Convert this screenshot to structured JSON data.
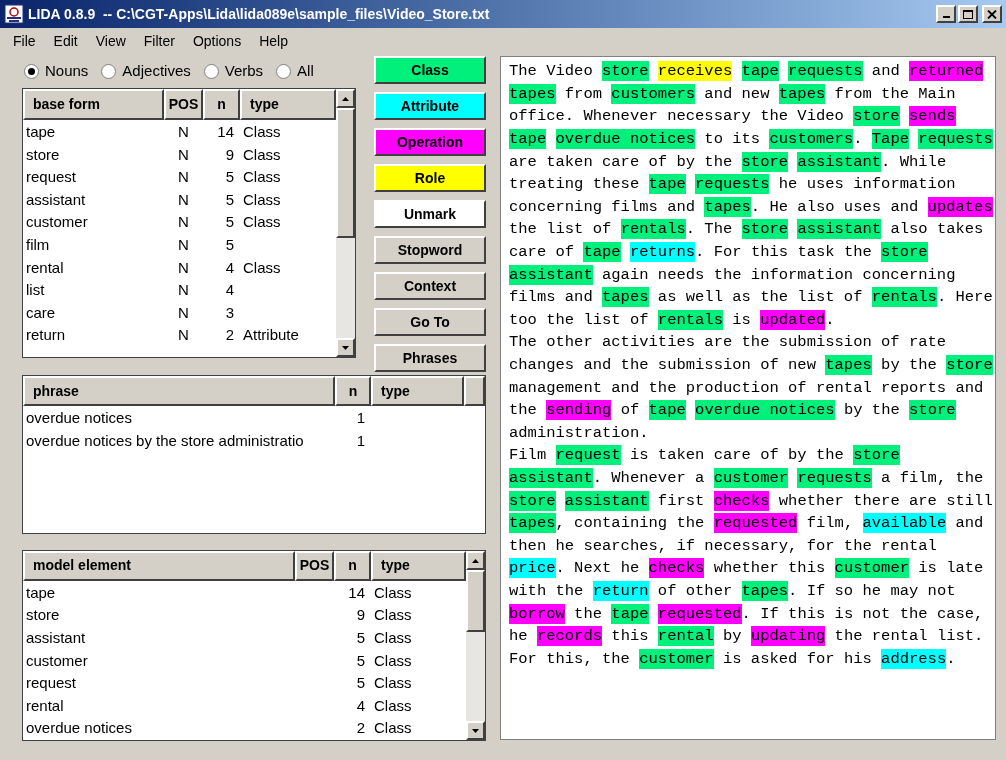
{
  "window": {
    "title": "LIDA 0.8.9  -- C:\\CGT-Apps\\Lida\\lida089e\\sample_files\\Video_Store.txt"
  },
  "menu": [
    "File",
    "Edit",
    "View",
    "Filter",
    "Options",
    "Help"
  ],
  "word_filter": [
    {
      "label": "Nouns",
      "selected": true
    },
    {
      "label": "Adjectives",
      "selected": false
    },
    {
      "label": "Verbs",
      "selected": false
    },
    {
      "label": "All",
      "selected": false
    }
  ],
  "words_table": {
    "columns": [
      "base form",
      "POS",
      "n",
      "type"
    ],
    "rows": [
      [
        "tape",
        "N",
        "14",
        "Class"
      ],
      [
        "store",
        "N",
        "9",
        "Class"
      ],
      [
        "request",
        "N",
        "5",
        "Class"
      ],
      [
        "assistant",
        "N",
        "5",
        "Class"
      ],
      [
        "customer",
        "N",
        "5",
        "Class"
      ],
      [
        "film",
        "N",
        "5"
      ],
      [
        "rental",
        "N",
        "4",
        "Class"
      ],
      [
        "list",
        "N",
        "4"
      ],
      [
        "care",
        "N",
        "3"
      ],
      [
        "return",
        "N",
        "2",
        "Attribute"
      ]
    ]
  },
  "buttons": [
    {
      "label": "Class",
      "kind": "class"
    },
    {
      "label": "Attribute",
      "kind": "attribute"
    },
    {
      "label": "Operation",
      "kind": "operation"
    },
    {
      "label": "Role",
      "kind": "role"
    },
    {
      "label": "Unmark",
      "kind": "unmark"
    },
    {
      "label": "Stopword",
      "kind": "plain"
    },
    {
      "label": "Context",
      "kind": "plain"
    },
    {
      "label": "Go To",
      "kind": "plain"
    },
    {
      "label": "Phrases",
      "kind": "plain"
    }
  ],
  "phrases_table": {
    "columns": [
      "phrase",
      "n",
      "type"
    ],
    "rows": [
      [
        "overdue notices",
        "1"
      ],
      [
        "overdue notices by the store administratio",
        "1"
      ]
    ]
  },
  "model_table": {
    "columns": [
      "model element",
      "POS",
      "n",
      "type"
    ],
    "rows": [
      [
        "tape",
        "",
        "14",
        "Class"
      ],
      [
        "store",
        "",
        "9",
        "Class"
      ],
      [
        "assistant",
        "",
        "5",
        "Class"
      ],
      [
        "customer",
        "",
        "5",
        "Class"
      ],
      [
        "request",
        "",
        "5",
        "Class"
      ],
      [
        "rental",
        "",
        "4",
        "Class"
      ],
      [
        "overdue notices",
        "",
        "2",
        "Class"
      ]
    ]
  },
  "text": {
    "lines": [
      [
        {
          "text": "The Video ",
          "kind": "plain"
        },
        {
          "text": "store",
          "kind": "class"
        },
        {
          "text": "receives",
          "kind": "role"
        },
        {
          "text": "tape",
          "kind": "class"
        },
        {
          "text": "requests",
          "kind": "class"
        },
        {
          "text": " and ",
          "kind": "plain"
        },
        {
          "text": "returned",
          "kind": "operation"
        }
      ],
      [
        {
          "text": "tapes",
          "kind": "class"
        },
        {
          "text": " from ",
          "kind": "plain"
        },
        {
          "text": "customers",
          "kind": "class"
        },
        {
          "text": " and new ",
          "kind": "plain"
        },
        {
          "text": "tapes",
          "kind": "class"
        },
        {
          "text": " from the Main",
          "kind": "plain"
        }
      ],
      [
        {
          "text": "office. Whenever necessary the Video ",
          "kind": "plain"
        },
        {
          "text": "store",
          "kind": "class"
        },
        {
          "text": "sends",
          "kind": "operation"
        }
      ],
      [
        {
          "text": "tape",
          "kind": "class"
        },
        {
          "text": "overdue notices",
          "kind": "class"
        },
        {
          "text": " to its ",
          "kind": "plain"
        },
        {
          "text": "customers",
          "kind": "class"
        },
        {
          "text": ". ",
          "kind": "plain"
        },
        {
          "text": "Tape",
          "kind": "class"
        },
        {
          "text": "requests",
          "kind": "class"
        }
      ],
      [
        {
          "text": "are taken care of by the ",
          "kind": "plain"
        },
        {
          "text": "store",
          "kind": "class"
        },
        {
          "text": "assistant",
          "kind": "class"
        },
        {
          "text": ". While",
          "kind": "plain"
        }
      ],
      [
        {
          "text": "treating these ",
          "kind": "plain"
        },
        {
          "text": "tape",
          "kind": "class"
        },
        {
          "text": "requests",
          "kind": "class"
        },
        {
          "text": " he uses information",
          "kind": "plain"
        }
      ],
      [
        {
          "text": "concerning films and ",
          "kind": "plain"
        },
        {
          "text": "tapes",
          "kind": "class"
        },
        {
          "text": ". He also uses and ",
          "kind": "plain"
        },
        {
          "text": "updates",
          "kind": "operation"
        }
      ],
      [
        {
          "text": "the list of ",
          "kind": "plain"
        },
        {
          "text": "rentals",
          "kind": "class"
        },
        {
          "text": ". The ",
          "kind": "plain"
        },
        {
          "text": "store",
          "kind": "class"
        },
        {
          "text": "assistant",
          "kind": "class"
        },
        {
          "text": " also takes",
          "kind": "plain"
        }
      ],
      [
        {
          "text": "care of ",
          "kind": "plain"
        },
        {
          "text": "tape",
          "kind": "class"
        },
        {
          "text": "returns",
          "kind": "attribute"
        },
        {
          "text": ". For this task the ",
          "kind": "plain"
        },
        {
          "text": "store",
          "kind": "class"
        }
      ],
      [
        {
          "text": "assistant",
          "kind": "class"
        },
        {
          "text": " again needs the information concerning",
          "kind": "plain"
        }
      ],
      [
        {
          "text": "films and ",
          "kind": "plain"
        },
        {
          "text": "tapes",
          "kind": "class"
        },
        {
          "text": " as well as the list of ",
          "kind": "plain"
        },
        {
          "text": "rentals",
          "kind": "class"
        },
        {
          "text": ". Here",
          "kind": "plain"
        }
      ],
      [
        {
          "text": "too the list of ",
          "kind": "plain"
        },
        {
          "text": "rentals",
          "kind": "class"
        },
        {
          "text": " is ",
          "kind": "plain"
        },
        {
          "text": "updated",
          "kind": "operation"
        },
        {
          "text": ".",
          "kind": "plain"
        }
      ],
      [
        {
          "text": "The other activities are the submission of rate",
          "kind": "plain"
        }
      ],
      [
        {
          "text": "changes and the submission of new ",
          "kind": "plain"
        },
        {
          "text": "tapes",
          "kind": "class"
        },
        {
          "text": " by the ",
          "kind": "plain"
        },
        {
          "text": "store",
          "kind": "class"
        }
      ],
      [
        {
          "text": "management and the production of rental reports and",
          "kind": "plain"
        }
      ],
      [
        {
          "text": "the ",
          "kind": "plain"
        },
        {
          "text": "sending",
          "kind": "operation"
        },
        {
          "text": " of ",
          "kind": "plain"
        },
        {
          "text": "tape",
          "kind": "class"
        },
        {
          "text": "overdue notices",
          "kind": "class"
        },
        {
          "text": " by the ",
          "kind": "plain"
        },
        {
          "text": "store",
          "kind": "class"
        }
      ],
      [
        {
          "text": "administration.",
          "kind": "plain"
        }
      ],
      [
        {
          "text": "Film ",
          "kind": "plain"
        },
        {
          "text": "request",
          "kind": "class"
        },
        {
          "text": " is taken care of by the ",
          "kind": "plain"
        },
        {
          "text": "store",
          "kind": "class"
        }
      ],
      [
        {
          "text": "assistant",
          "kind": "class"
        },
        {
          "text": ". Whenever a ",
          "kind": "plain"
        },
        {
          "text": "customer",
          "kind": "class"
        },
        {
          "text": "requests",
          "kind": "class"
        },
        {
          "text": " a film, the",
          "kind": "plain"
        }
      ],
      [
        {
          "text": "store",
          "kind": "class"
        },
        {
          "text": "assistant",
          "kind": "class"
        },
        {
          "text": " first ",
          "kind": "plain"
        },
        {
          "text": "checks",
          "kind": "operation"
        },
        {
          "text": " whether there are still",
          "kind": "plain"
        }
      ],
      [
        {
          "text": "tapes",
          "kind": "class"
        },
        {
          "text": ", containing the ",
          "kind": "plain"
        },
        {
          "text": "requested",
          "kind": "operation"
        },
        {
          "text": " film, ",
          "kind": "plain"
        },
        {
          "text": "available",
          "kind": "attribute"
        },
        {
          "text": " and",
          "kind": "plain"
        }
      ],
      [
        {
          "text": "then he searches, if necessary, for the rental",
          "kind": "plain"
        }
      ],
      [
        {
          "text": "price",
          "kind": "attribute"
        },
        {
          "text": ". Next he ",
          "kind": "plain"
        },
        {
          "text": "checks",
          "kind": "operation"
        },
        {
          "text": " whether this ",
          "kind": "plain"
        },
        {
          "text": "customer",
          "kind": "class"
        },
        {
          "text": " is late",
          "kind": "plain"
        }
      ],
      [
        {
          "text": "with the ",
          "kind": "plain"
        },
        {
          "text": "return",
          "kind": "attribute"
        },
        {
          "text": " of other ",
          "kind": "plain"
        },
        {
          "text": "tapes",
          "kind": "class"
        },
        {
          "text": ". If so he may not",
          "kind": "plain"
        }
      ],
      [
        {
          "text": "borrow",
          "kind": "operation"
        },
        {
          "text": " the ",
          "kind": "plain"
        },
        {
          "text": "tape",
          "kind": "class"
        },
        {
          "text": "requested",
          "kind": "operation"
        },
        {
          "text": ". If this is not the case,",
          "kind": "plain"
        }
      ],
      [
        {
          "text": "he ",
          "kind": "plain"
        },
        {
          "text": "records",
          "kind": "operation"
        },
        {
          "text": " this ",
          "kind": "plain"
        },
        {
          "text": "rental",
          "kind": "class"
        },
        {
          "text": " by ",
          "kind": "plain"
        },
        {
          "text": "updating",
          "kind": "operation"
        },
        {
          "text": " the rental list.",
          "kind": "plain"
        }
      ],
      [
        {
          "text": "For this, the ",
          "kind": "plain"
        },
        {
          "text": "customer",
          "kind": "class"
        },
        {
          "text": " is asked for his ",
          "kind": "plain"
        },
        {
          "text": "address",
          "kind": "attribute"
        },
        {
          "text": ".",
          "kind": "plain"
        }
      ]
    ]
  }
}
